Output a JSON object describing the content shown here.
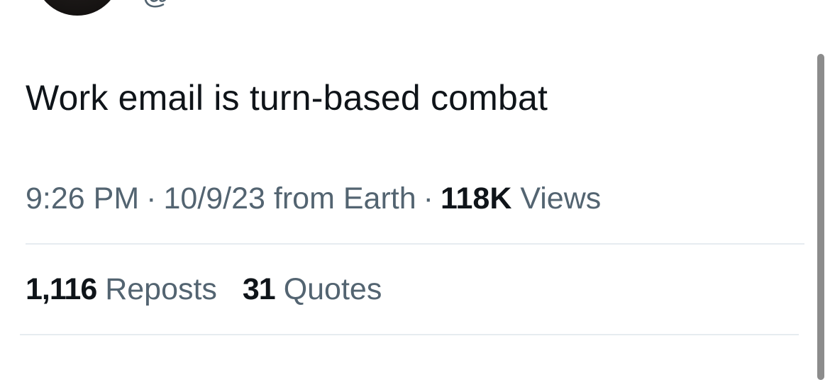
{
  "author": {
    "handle": "@"
  },
  "tweet": {
    "text": "Work email is turn-based combat",
    "time": "9:26 PM",
    "separator": "·",
    "date": "10/9/23",
    "source_prefix": "from",
    "source": "Earth",
    "views_count": "118K",
    "views_label": "Views"
  },
  "stats": {
    "reposts_count": "1,116",
    "reposts_label": "Reposts",
    "quotes_count": "31",
    "quotes_label": "Quotes"
  }
}
